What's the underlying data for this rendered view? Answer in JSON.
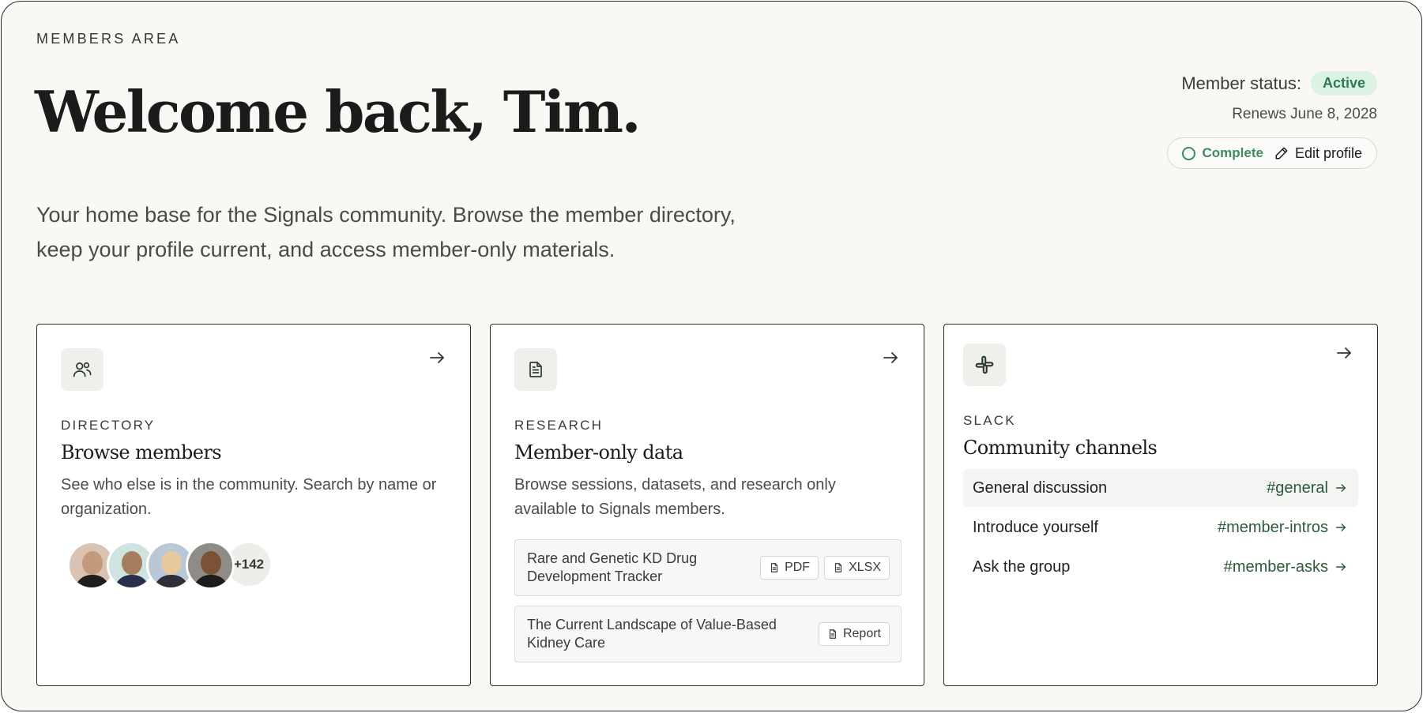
{
  "header": {
    "eyebrow": "MEMBERS AREA",
    "title": "Welcome back, Tim.",
    "intro_line1": "Your home base for the Signals community. Browse the member directory,",
    "intro_line2": "keep your profile current, and access member-only materials."
  },
  "status": {
    "label": "Member status:",
    "badge": "Active",
    "renews": "Renews June 8, 2028",
    "profile_state": "Complete",
    "edit_label": "Edit profile"
  },
  "cards": {
    "directory": {
      "kicker": "DIRECTORY",
      "title": "Browse members",
      "description": "See who else is in the community. Search by name or organization.",
      "more_count": "+142"
    },
    "research": {
      "kicker": "RESEARCH",
      "title": "Member-only data",
      "description": "Browse sessions, datasets, and research only available to Signals members.",
      "files": [
        {
          "name": "Rare and Genetic KD Drug Development Tracker",
          "formats": [
            "PDF",
            "XLSX"
          ]
        },
        {
          "name": "The Current Landscape of Value-Based Kidney Care",
          "formats": [
            "Report"
          ]
        }
      ]
    },
    "slack": {
      "kicker": "SLACK",
      "title": "Community channels",
      "channels": [
        {
          "name": "General discussion",
          "tag": "#general"
        },
        {
          "name": "Introduce yourself",
          "tag": "#member-intros"
        },
        {
          "name": "Ask the group",
          "tag": "#member-asks"
        }
      ]
    }
  },
  "colors": {
    "page_bg": "#f9f8f4",
    "accent_green": "#3f8a60",
    "badge_bg": "#dcf3e4",
    "channel_tag": "#2d5a3c"
  },
  "icons": [
    "users-icon",
    "document-icon",
    "slack-icon",
    "arrow-right-icon",
    "pencil-icon",
    "file-icon"
  ]
}
